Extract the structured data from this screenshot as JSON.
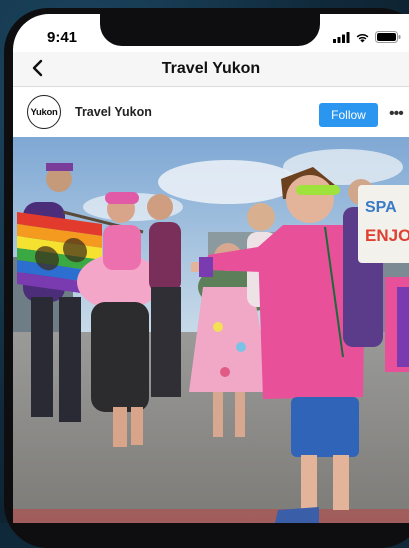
{
  "status_bar": {
    "time": "9:41"
  },
  "nav": {
    "title": "Travel Yukon"
  },
  "post": {
    "account_name": "Travel Yukon",
    "avatar_text": "Yukon",
    "follow_label": "Follow",
    "more_label": "•••"
  },
  "photo": {
    "description_sign_text": "ENJO",
    "sign_text_2": "SPA"
  },
  "colors": {
    "follow_blue": "#2b96f0",
    "shirt_pink": "#e8509a",
    "background": "#10293a"
  },
  "icons": {
    "back": "chevron-left-icon",
    "signal": "signal-icon",
    "wifi": "wifi-icon",
    "battery": "battery-icon"
  }
}
